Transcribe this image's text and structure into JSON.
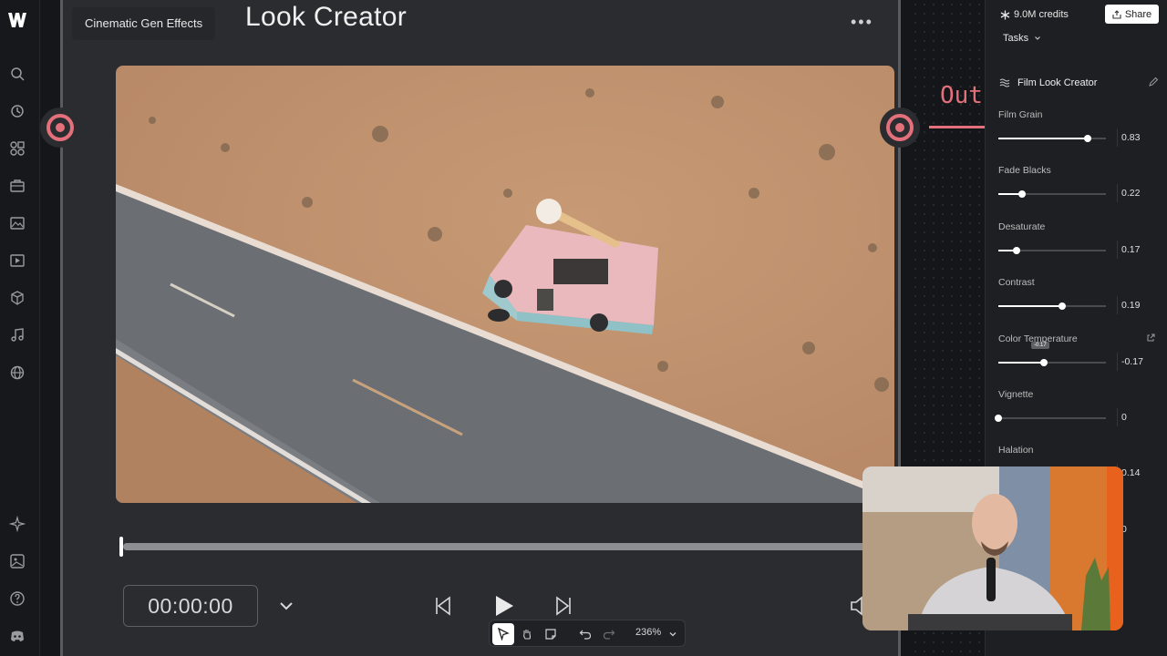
{
  "rail": {
    "items": [
      "app-logo",
      "search-icon",
      "history-icon",
      "apps-icon",
      "briefcase-icon",
      "image-icon",
      "video-icon",
      "cube-icon",
      "music-icon",
      "globe-icon",
      "sparkles-icon",
      "gallery-icon",
      "help-icon",
      "discord-icon"
    ]
  },
  "node": {
    "tooltip": "Cinematic Gen Effects",
    "title": "Look Creator",
    "output_label": "Out"
  },
  "player": {
    "timecode": "00:00:00",
    "playhead_fraction": 0.0
  },
  "toolbar": {
    "zoom": "236%"
  },
  "panel": {
    "credits": "9.0M credits",
    "share_label": "Share",
    "tasks_label": "Tasks",
    "effect_title": "Film Look Creator",
    "params": [
      {
        "label": "Film Grain",
        "value": "0.83",
        "level": 0.83
      },
      {
        "label": "Fade Blacks",
        "value": "0.22",
        "level": 0.22
      },
      {
        "label": "Desaturate",
        "value": "0.17",
        "level": 0.17
      },
      {
        "label": "Contrast",
        "value": "0.19",
        "level": 0.59
      },
      {
        "label": "Color Temperature",
        "value": "-0.17",
        "level": 0.42
      },
      {
        "label": "Vignette",
        "value": "0",
        "level": 0.0
      },
      {
        "label": "Halation",
        "value": "0.14",
        "level": null
      },
      {
        "label": "",
        "value": "0",
        "level": null
      }
    ],
    "slider_tip": "-0.17"
  },
  "colors": {
    "accent": "#e3707a",
    "panel_bg": "#1e1f22",
    "canvas_bg": "#151619",
    "node_bg": "#2b2c30"
  }
}
